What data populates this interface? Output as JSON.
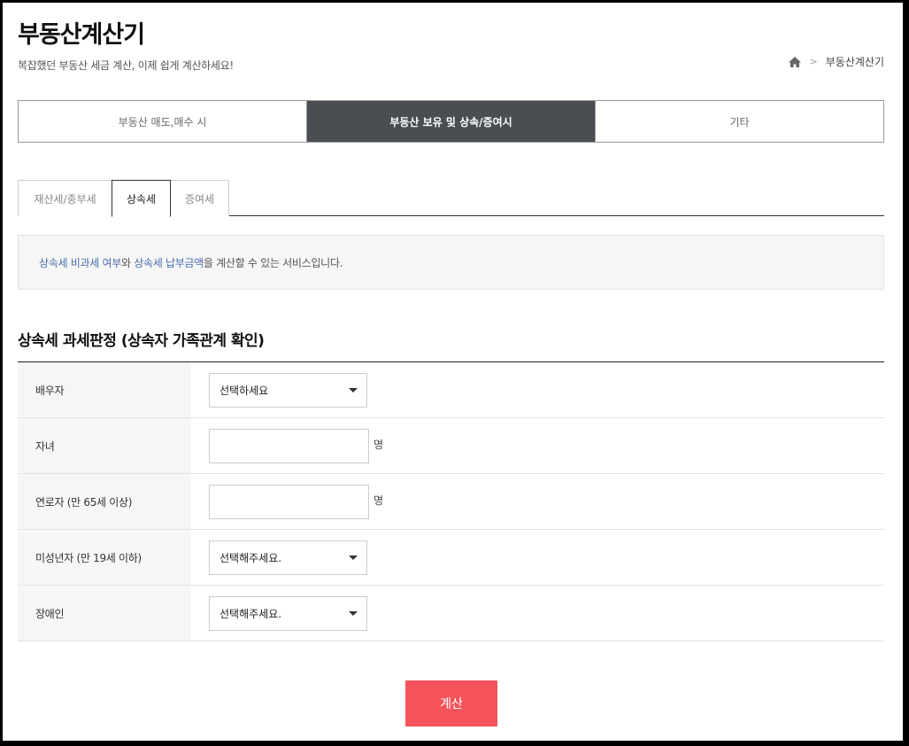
{
  "header": {
    "title": "부동산계산기",
    "subtitle": "복잡했던 부동산 세금 계산, 이제 쉽게 계산하세요!",
    "breadcrumb": {
      "home_icon": "home-icon",
      "current": "부동산계산기"
    }
  },
  "main_tabs": [
    {
      "label": "부동산 매도,매수 시",
      "active": false
    },
    {
      "label": "부동산 보유 및 상속/증여시",
      "active": true
    },
    {
      "label": "기타",
      "active": false
    }
  ],
  "sub_tabs": [
    {
      "label": "재산세/종부세",
      "active": false
    },
    {
      "label": "상속세",
      "active": true
    },
    {
      "label": "증여세",
      "active": false
    }
  ],
  "info": {
    "highlight_1": "상속세 비과세 여부",
    "connector": "와 ",
    "highlight_2": "상속세 납부금액",
    "rest": "을 계산할 수 있는 서비스입니다."
  },
  "section": {
    "title": "상속세 과세판정 (상속자 가족관계 확인)"
  },
  "form": {
    "rows": [
      {
        "label": "배우자",
        "type": "select",
        "value": "선택하세요"
      },
      {
        "label": "자녀",
        "type": "number",
        "value": "",
        "unit": "명"
      },
      {
        "label": "연로자 (만 65세 이상)",
        "type": "number",
        "value": "",
        "unit": "명"
      },
      {
        "label": "미성년자 (만 19세 이하)",
        "type": "select",
        "value": "선택해주세요."
      },
      {
        "label": "장애인",
        "type": "select",
        "value": "선택해주세요."
      }
    ]
  },
  "actions": {
    "calculate_label": "계산",
    "button_color": "#f5535b"
  },
  "colors": {
    "active_tab_bg": "#4a4e52",
    "info_highlight": "#4a6fb0"
  }
}
